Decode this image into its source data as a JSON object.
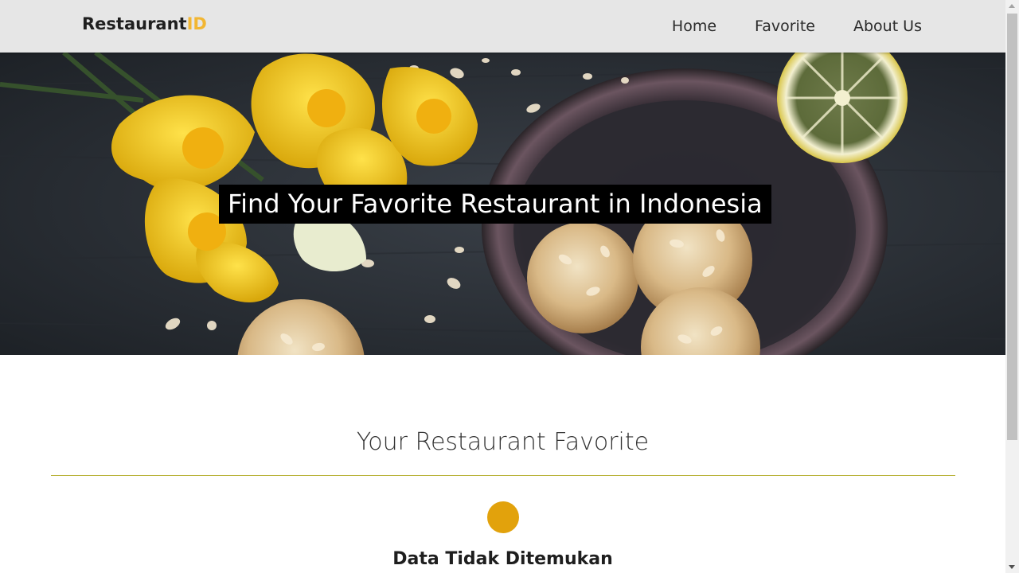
{
  "header": {
    "brand_main": "Restaurant",
    "brand_accent": "ID",
    "nav": [
      {
        "label": "Home"
      },
      {
        "label": "Favorite"
      },
      {
        "label": "About Us"
      }
    ]
  },
  "hero": {
    "title": "Find Your Favorite Restaurant in Indonesia"
  },
  "main": {
    "section_title": "Your Restaurant Favorite",
    "empty_state": {
      "icon": "empty-dot-icon",
      "message": "Data Tidak Ditemukan"
    }
  },
  "colors": {
    "brand_accent": "#f2b632",
    "divider": "#b9b33a",
    "empty_icon": "#e2a20c",
    "app_bar": "#e6e6e6"
  }
}
